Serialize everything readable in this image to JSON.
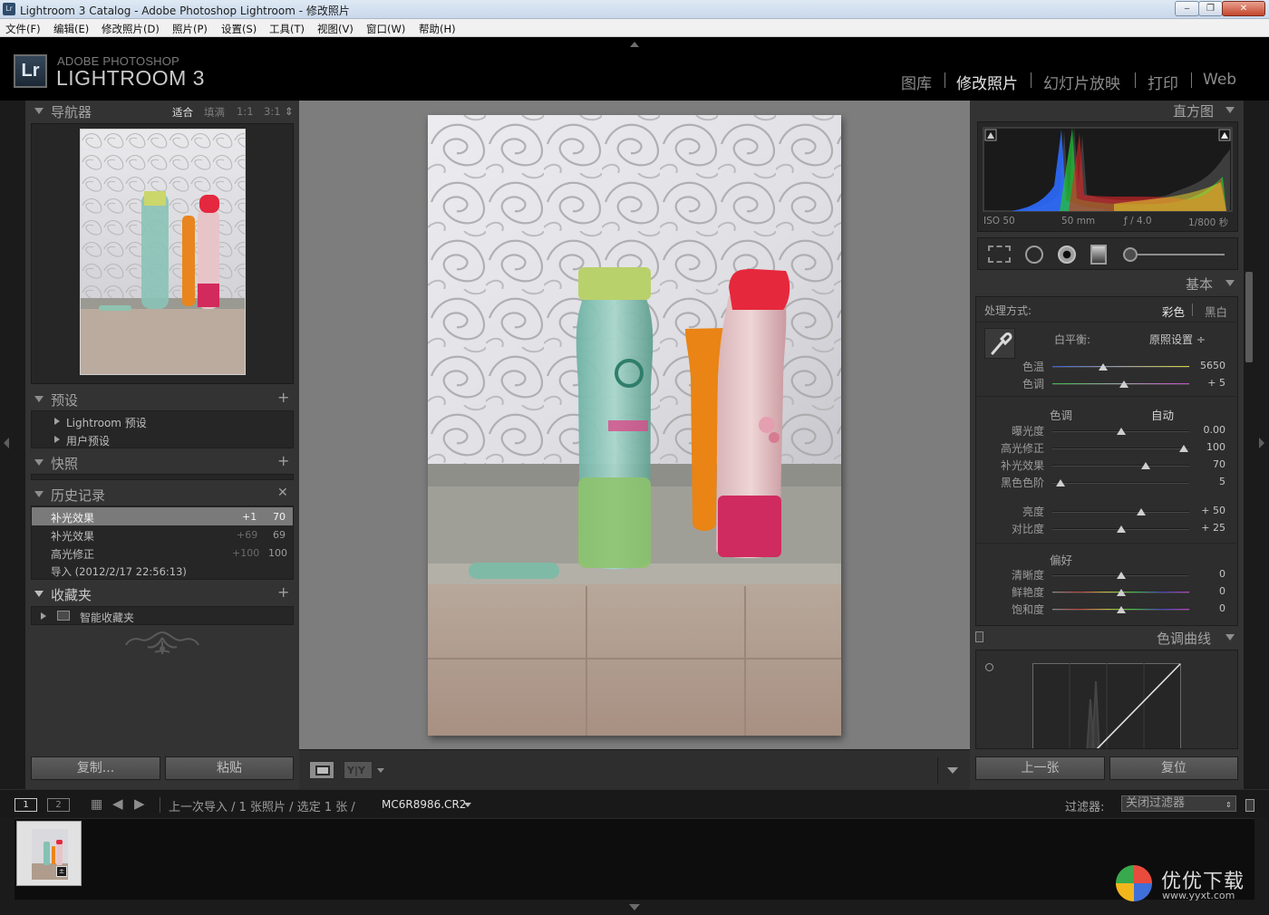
{
  "window": {
    "title": "Lightroom 3 Catalog - Adobe Photoshop Lightroom - 修改照片",
    "app_icon_label": "Lr",
    "buttons": {
      "minimize": "‒",
      "maximize": "❐",
      "close": "✕"
    }
  },
  "menu": [
    "文件(F)",
    "编辑(E)",
    "修改照片(D)",
    "照片(P)",
    "设置(S)",
    "工具(T)",
    "视图(V)",
    "窗口(W)",
    "帮助(H)"
  ],
  "brand": {
    "logo": "Lr",
    "line1": "ADOBE PHOTOSHOP",
    "line2": "LIGHTROOM 3"
  },
  "modules": [
    {
      "label": "图库",
      "active": false
    },
    {
      "label": "修改照片",
      "active": true
    },
    {
      "label": "幻灯片放映",
      "active": false
    },
    {
      "label": "打印",
      "active": false
    },
    {
      "label": "Web",
      "active": false
    }
  ],
  "left": {
    "navigator": {
      "title": "导航器",
      "zoom": [
        "适合",
        "填满",
        "1:1",
        "3:1"
      ],
      "zoom_active": "适合"
    },
    "presets": {
      "title": "预设",
      "items": [
        "Lightroom 预设",
        "用户预设"
      ]
    },
    "snapshots": {
      "title": "快照"
    },
    "history": {
      "title": "历史记录",
      "items": [
        {
          "label": "补光效果",
          "step": "+1",
          "value": "70",
          "selected": true
        },
        {
          "label": "补光效果",
          "step": "+69",
          "value": "69",
          "selected": false
        },
        {
          "label": "高光修正",
          "step": "+100",
          "value": "100",
          "selected": false
        },
        {
          "label": "导入 (2012/2/17 22:56:13)",
          "step": "",
          "value": "",
          "selected": false
        }
      ]
    },
    "collections": {
      "title": "收藏夹",
      "items": [
        "智能收藏夹"
      ]
    },
    "copy_button": "复制...",
    "paste_button": "粘贴"
  },
  "right": {
    "histogram": {
      "title": "直方图",
      "iso": "ISO 50",
      "focal": "50 mm",
      "aperture": "ƒ / 4.0",
      "shutter": "1/800 秒"
    },
    "basic": {
      "title": "基本",
      "treatment_label": "处理方式:",
      "treatment_color": "彩色",
      "treatment_bw": "黑白",
      "wb_label": "白平衡:",
      "wb_value": "原照设置 ÷",
      "tone_label": "色调",
      "tone_auto": "自动",
      "presence_label": "偏好",
      "sliders": {
        "temp": {
          "label": "色温",
          "value": "5650",
          "pos": 0.37
        },
        "tint": {
          "label": "色调",
          "value": "+ 5",
          "pos": 0.52
        },
        "exposure": {
          "label": "曝光度",
          "value": "0.00",
          "pos": 0.5
        },
        "recovery": {
          "label": "高光修正",
          "value": "100",
          "pos": 0.96
        },
        "fill": {
          "label": "补光效果",
          "value": "70",
          "pos": 0.68
        },
        "blacks": {
          "label": "黑色色阶",
          "value": "5",
          "pos": 0.06
        },
        "brightness": {
          "label": "亮度",
          "value": "+ 50",
          "pos": 0.65
        },
        "contrast": {
          "label": "对比度",
          "value": "+ 25",
          "pos": 0.5
        },
        "clarity": {
          "label": "清晰度",
          "value": "0",
          "pos": 0.5
        },
        "vibrance": {
          "label": "鲜艳度",
          "value": "0",
          "pos": 0.5
        },
        "saturation": {
          "label": "饱和度",
          "value": "0",
          "pos": 0.5
        }
      }
    },
    "tone_curve": {
      "title": "色调曲线"
    },
    "prev_button": "上一张",
    "reset_button": "复位"
  },
  "filmstrip": {
    "pages": [
      "1",
      "2"
    ],
    "path_text": "上一次导入 / 1 张照片 / 选定 1 张 /",
    "filename": "MC6R8986.CR2",
    "filter_label": "过滤器:",
    "filter_value": "关闭过滤器"
  },
  "watermark": {
    "text": "优优下载",
    "url": "www.yyxt.com"
  },
  "colors": {
    "active_module": "#e4e4e4",
    "panel_bg": "#333333",
    "canvas_bg": "#7d7d7d"
  }
}
